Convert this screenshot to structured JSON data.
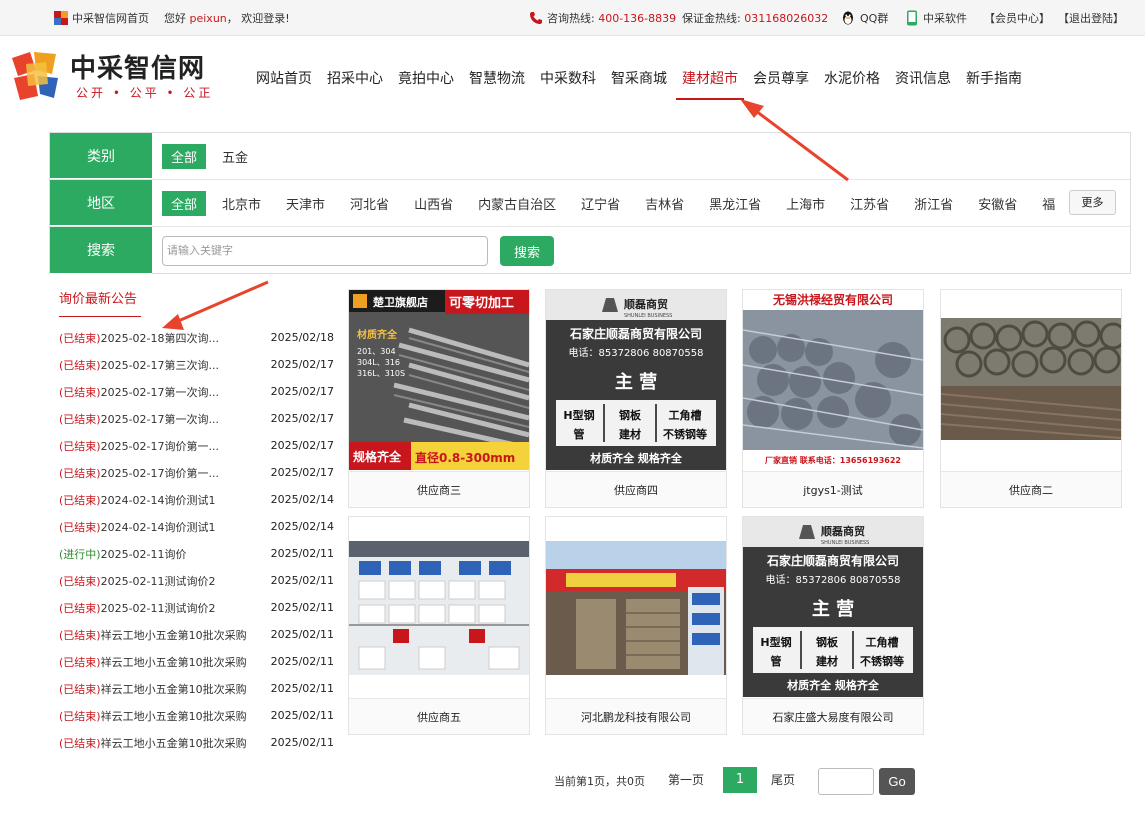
{
  "topbar": {
    "home_link": "中采智信网首页",
    "greeting_prefix": "您好",
    "username": "peixun",
    "greeting_suffix": "，  欢迎登录!",
    "hotline_label": "咨询热线:",
    "hotline_number": "400-136-8839",
    "deposit_label": "保证金热线:",
    "deposit_number": "031168026032",
    "qq_group": "QQ群",
    "software": "中采软件",
    "member_center": "【会员中心】",
    "logout": "【退出登陆】"
  },
  "header": {
    "logo_title": "中采智信网",
    "logo_slogan": "公开 • 公平 • 公正",
    "nav": [
      "网站首页",
      "招采中心",
      "竟拍中心",
      "智慧物流",
      "中采数科",
      "智采商城",
      "建材超市",
      "会员尊享",
      "水泥价格",
      "资讯信息",
      "新手指南"
    ],
    "active_nav": "建材超市"
  },
  "filter": {
    "category_label": "类别",
    "category_options": [
      "全部",
      "五金"
    ],
    "region_label": "地区",
    "region_options": [
      "全部",
      "北京市",
      "天津市",
      "河北省",
      "山西省",
      "内蒙古自治区",
      "辽宁省",
      "吉林省",
      "黑龙江省",
      "上海市",
      "江苏省",
      "浙江省",
      "安徽省",
      "福"
    ],
    "more_button": "更多",
    "search_label": "搜索",
    "search_placeholder": "请输入关键字",
    "search_button": "搜索"
  },
  "notices": {
    "title": "询价最新公告",
    "items": [
      {
        "status": "(已结束)",
        "title": "2025-02-18第四次询...",
        "date": "2025/02/18"
      },
      {
        "status": "(已结束)",
        "title": "2025-02-17第三次询...",
        "date": "2025/02/17"
      },
      {
        "status": "(已结束)",
        "title": "2025-02-17第一次询...",
        "date": "2025/02/17"
      },
      {
        "status": "(已结束)",
        "title": "2025-02-17第一次询...",
        "date": "2025/02/17"
      },
      {
        "status": "(已结束)",
        "title": "2025-02-17询价第一...",
        "date": "2025/02/17"
      },
      {
        "status": "(已结束)",
        "title": "2025-02-17询价第一...",
        "date": "2025/02/17"
      },
      {
        "status": "(已结束)",
        "title": "2024-02-14询价测试1",
        "date": "2025/02/14"
      },
      {
        "status": "(已结束)",
        "title": "2024-02-14询价测试1",
        "date": "2025/02/14"
      },
      {
        "status": "(进行中)",
        "title": "2025-02-11询价",
        "date": "2025/02/11"
      },
      {
        "status": "(已结束)",
        "title": "2025-02-11测试询价2",
        "date": "2025/02/11"
      },
      {
        "status": "(已结束)",
        "title": "2025-02-11测试询价2",
        "date": "2025/02/11"
      },
      {
        "status": "(已结束)",
        "title": "祥云工地小五金第10批次采购",
        "date": "2025/02/11"
      },
      {
        "status": "(已结束)",
        "title": "祥云工地小五金第10批次采购",
        "date": "2025/02/11"
      },
      {
        "status": "(已结束)",
        "title": "祥云工地小五金第10批次采购",
        "date": "2025/02/11"
      },
      {
        "status": "(已结束)",
        "title": "祥云工地小五金第10批次采购",
        "date": "2025/02/11"
      },
      {
        "status": "(已结束)",
        "title": "祥云工地小五金第10批次采购",
        "date": "2025/02/11"
      }
    ]
  },
  "suppliers": [
    {
      "name": "供应商三",
      "image": "steel-pipes-ad",
      "ad": {
        "shop": "楚卫旗舰店",
        "banner": "可零切加工",
        "tag": "材质齐全",
        "specs": [
          "201、304",
          "304L、316",
          "316L、310S"
        ],
        "footer_left": "规格齐全",
        "footer_right": "直径0.8-300mm"
      }
    },
    {
      "name": "供应商四",
      "image": "shunlei-trade-ad",
      "ad": {
        "brand": "顺磊商贸",
        "brand_en": "SHUNLEI BUSINESS",
        "company": "石家庄顺磊商贸有限公司",
        "phone": "电话：85372806  80870558",
        "heading": "主 营",
        "products_row1": [
          "H型钢",
          "钢板",
          "工角槽"
        ],
        "products_row2": [
          "管",
          "建材",
          "不锈钢等"
        ],
        "footer": "材质齐全  规格齐全"
      }
    },
    {
      "name": "jtgys1-测试",
      "image": "rebar-bundles-ad",
      "ad": {
        "company": "无锡洪禄经贸有限公司",
        "footer": "厂家直销  联系电话：13656193622"
      }
    },
    {
      "name": "供应商二",
      "image": "rebar-coils-photo"
    },
    {
      "name": "供应商五",
      "image": "hardware-store-photo"
    },
    {
      "name": "河北鹏龙科技有限公司",
      "image": "storefront-photo"
    },
    {
      "name": "石家庄盛大易度有限公司",
      "image": "shunlei-trade-ad",
      "ad": {
        "brand": "顺磊商贸",
        "brand_en": "SHUNLEI BUSINESS",
        "company": "石家庄顺磊商贸有限公司",
        "phone": "电话：85372806  80870558",
        "heading": "主 营",
        "products_row1": [
          "H型钢",
          "钢板",
          "工角槽"
        ],
        "products_row2": [
          "管",
          "建材",
          "不锈钢等"
        ],
        "footer": "材质齐全  规格齐全"
      }
    }
  ],
  "pagination": {
    "summary": "当前第1页，共0页",
    "first": "第一页",
    "current": "1",
    "last": "尾页",
    "go": "Go"
  },
  "colors": {
    "brand_green": "#2daa62",
    "accent_red": "#c8161d"
  }
}
